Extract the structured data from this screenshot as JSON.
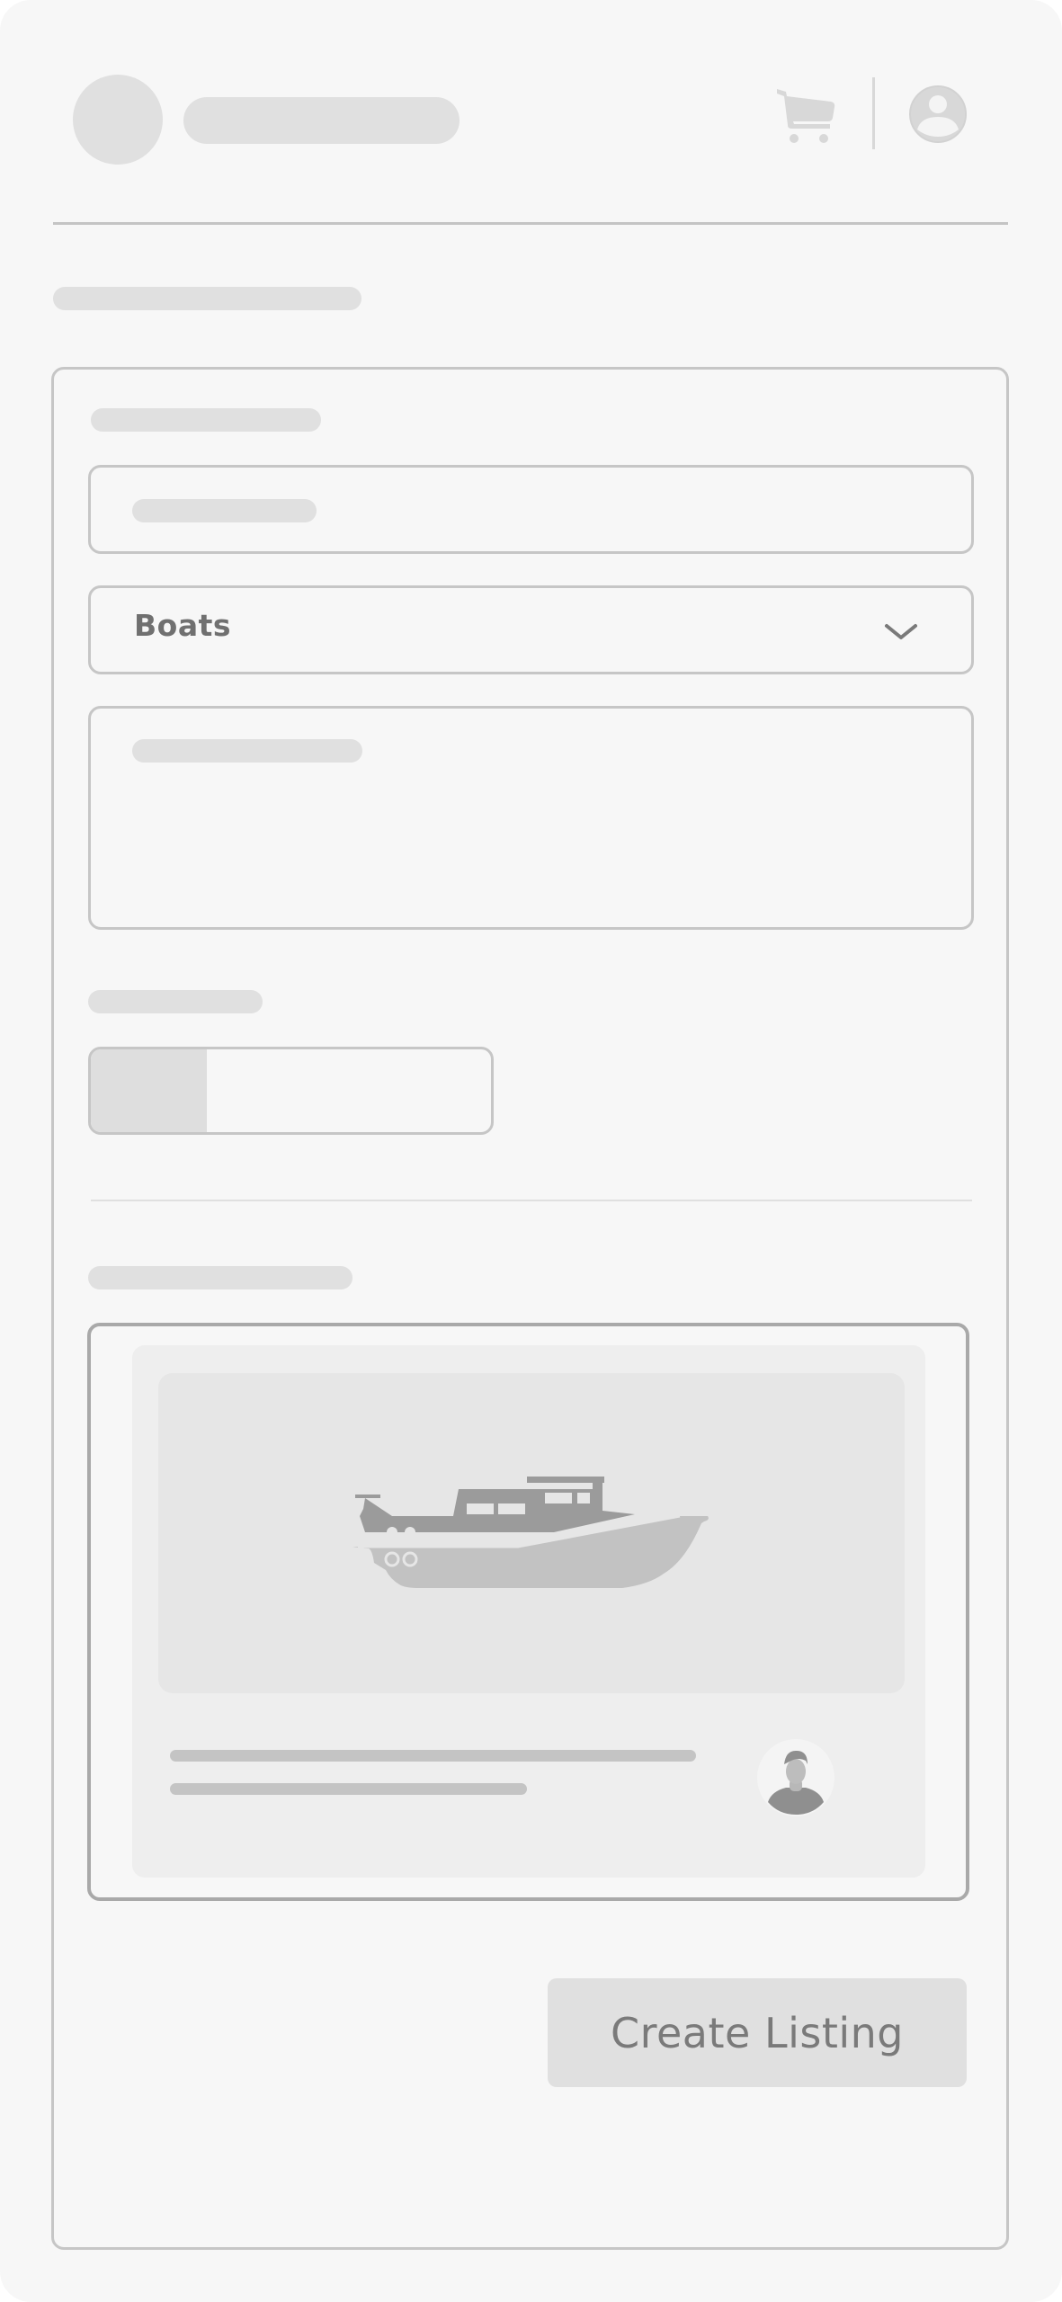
{
  "form": {
    "category_select": {
      "value": "Boats"
    }
  },
  "actions": {
    "submit_label": "Create Listing"
  },
  "icons": {
    "header_cart": "shopping-cart-icon",
    "header_profile": "user-avatar-icon",
    "select_chevron": "chevron-down-icon",
    "preview_image": "boat-image",
    "preview_seller": "seller-avatar-icon"
  },
  "colors": {
    "background": "#f7f7f7",
    "placeholder": "#e0e0e0",
    "border": "#c6c6c6",
    "text_muted": "#707070"
  }
}
